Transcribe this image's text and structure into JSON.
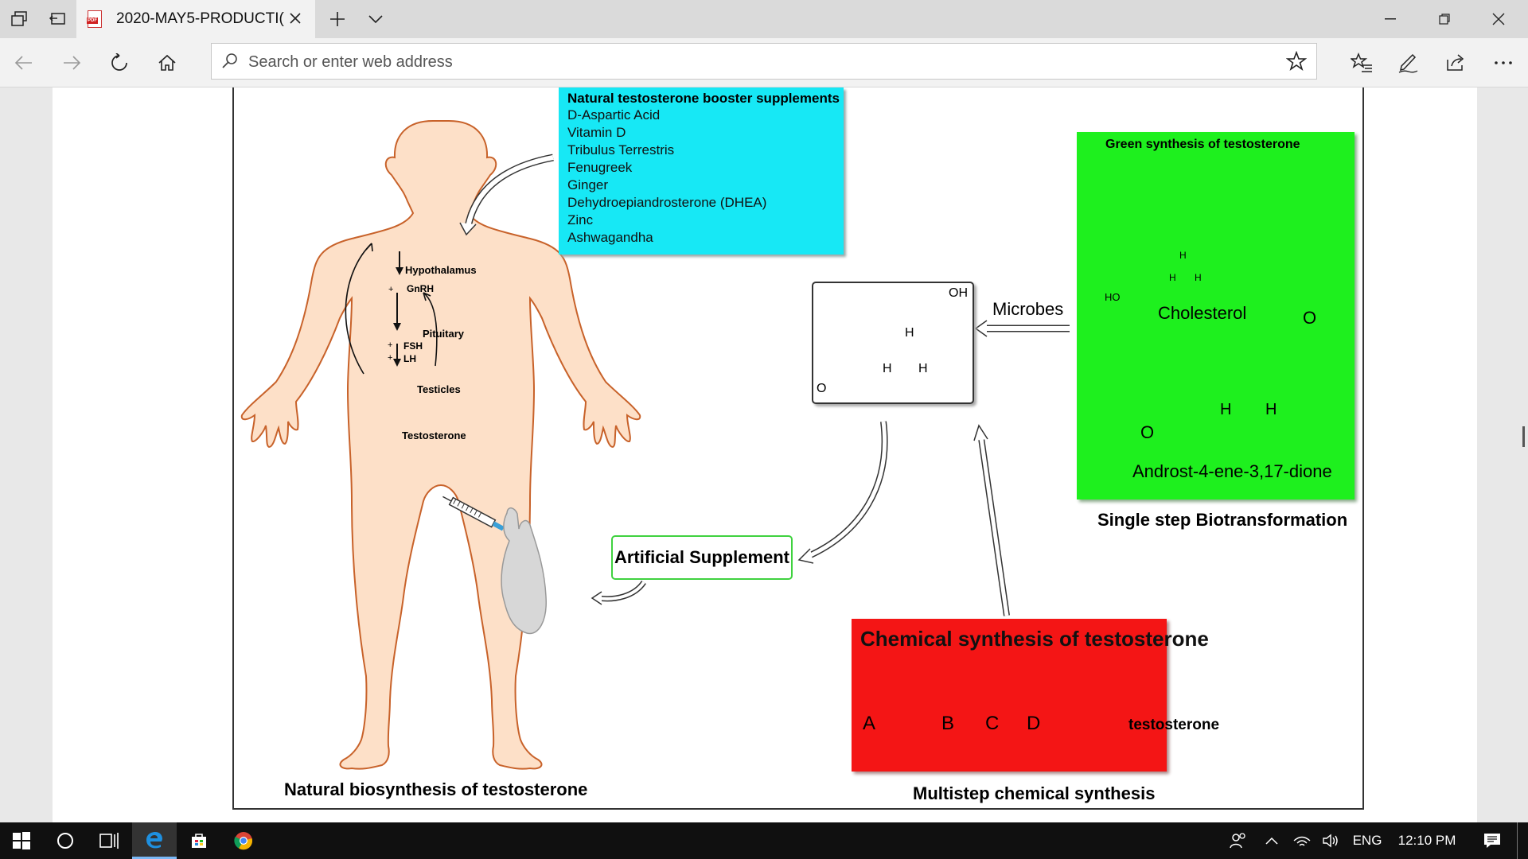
{
  "browser": {
    "tab_title": "2020-MAY5-PRODUCTI(",
    "address_placeholder": "Search or enter web address",
    "accent": "#d02020"
  },
  "figure": {
    "supplements": {
      "heading": "Natural testosterone booster supplements",
      "items": [
        "D-Aspartic Acid",
        "Vitamin D",
        "Tribulus Terrestris",
        "Fenugreek",
        "Ginger",
        "Dehydroepiandrosterone (DHEA)",
        "Zinc",
        "Ashwagandha"
      ],
      "color": "#17e8f5"
    },
    "hormone_axis": {
      "hypothalamus": "Hypothalamus",
      "gnrh": "GnRH",
      "pituitary": "Pituitary",
      "fsh": "FSH",
      "lh": "LH",
      "testicles": "Testicles",
      "testosterone": "Testosterone",
      "plus": "+"
    },
    "natural_caption": "Natural biosynthesis of testosterone",
    "artificial_label": "Artificial Supplement",
    "oh_label": "OH",
    "h_label": "H",
    "o_label": "O",
    "ho_label": "HO",
    "microbes_label": "Microbes",
    "green": {
      "heading": "Green synthesis of testosterone",
      "cholesterol": "Cholesterol",
      "androst": "Androst-4-ene-3,17-dione",
      "color": "#1ef01e"
    },
    "single_step_caption": "Single step Biotransformation",
    "chemical": {
      "heading": "Chemical synthesis of testosterone",
      "steps": [
        "A",
        "B",
        "C",
        "D"
      ],
      "product": "testosterone",
      "color": "#f41515"
    },
    "multistep_caption": "Multistep chemical synthesis",
    "body_color": "#fde0c8"
  },
  "taskbar": {
    "language": "ENG",
    "time": "12:10 PM"
  }
}
